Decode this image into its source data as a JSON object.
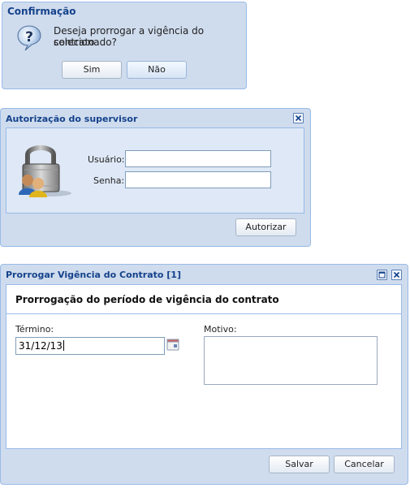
{
  "confirm_dialog": {
    "title": "Confirmação",
    "message_line1": "Deseja prorrogar a vigência do contrato",
    "message_line2": "selecionado?",
    "yes_label": "Sim",
    "no_label": "Não",
    "icon": "question-icon"
  },
  "auth_dialog": {
    "title": "Autorização do supervisor",
    "user_label": "Usuário:",
    "user_value": "",
    "password_label": "Senha:",
    "password_value": "",
    "authorize_label": "Autorizar",
    "icon": "lock-users-icon"
  },
  "extend_dialog": {
    "title": "Prorrogar Vigência do Contrato [1]",
    "heading": "Prorrogação do período de vigência do contrato",
    "end_label": "Término:",
    "end_value": "31/12/13",
    "reason_label": "Motivo:",
    "reason_value": "",
    "save_label": "Salvar",
    "cancel_label": "Cancelar"
  },
  "colors": {
    "title_text": "#15428b",
    "window_bg": "#cfdcee",
    "window_border": "#99bbe8"
  }
}
